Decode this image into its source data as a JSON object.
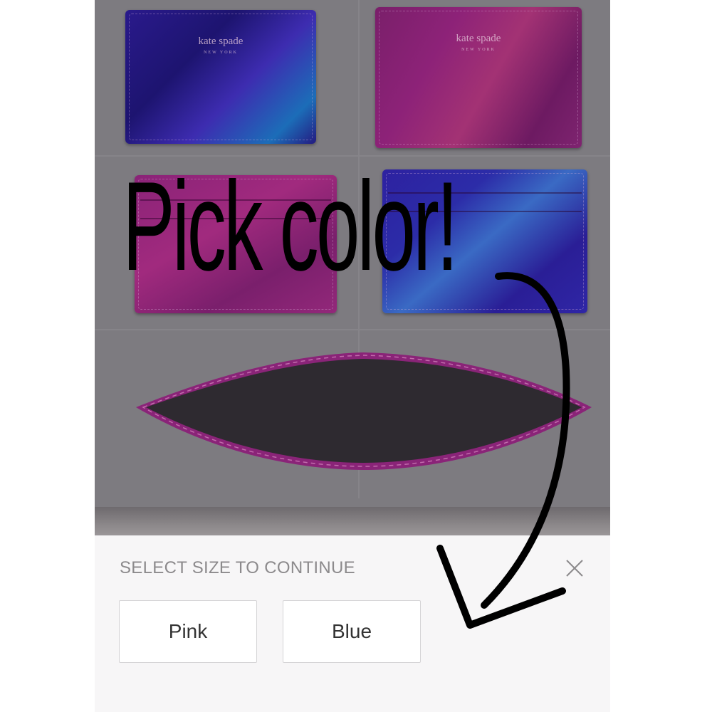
{
  "overlay": {
    "caption": "Pick color!"
  },
  "product_photo": {
    "brand_name": "kate spade",
    "brand_sub": "NEW YORK"
  },
  "sheet": {
    "title": "SELECT SIZE TO CONTINUE",
    "close_icon": "close-icon",
    "options": [
      {
        "label": "Pink"
      },
      {
        "label": "Blue"
      }
    ]
  },
  "colors": {
    "sheet_background": "#f7f6f7",
    "title_text": "#8c8a8c",
    "option_border": "#d5d4d6",
    "pink_card": "#8d2278",
    "blue_card": "#2a1a8c"
  }
}
